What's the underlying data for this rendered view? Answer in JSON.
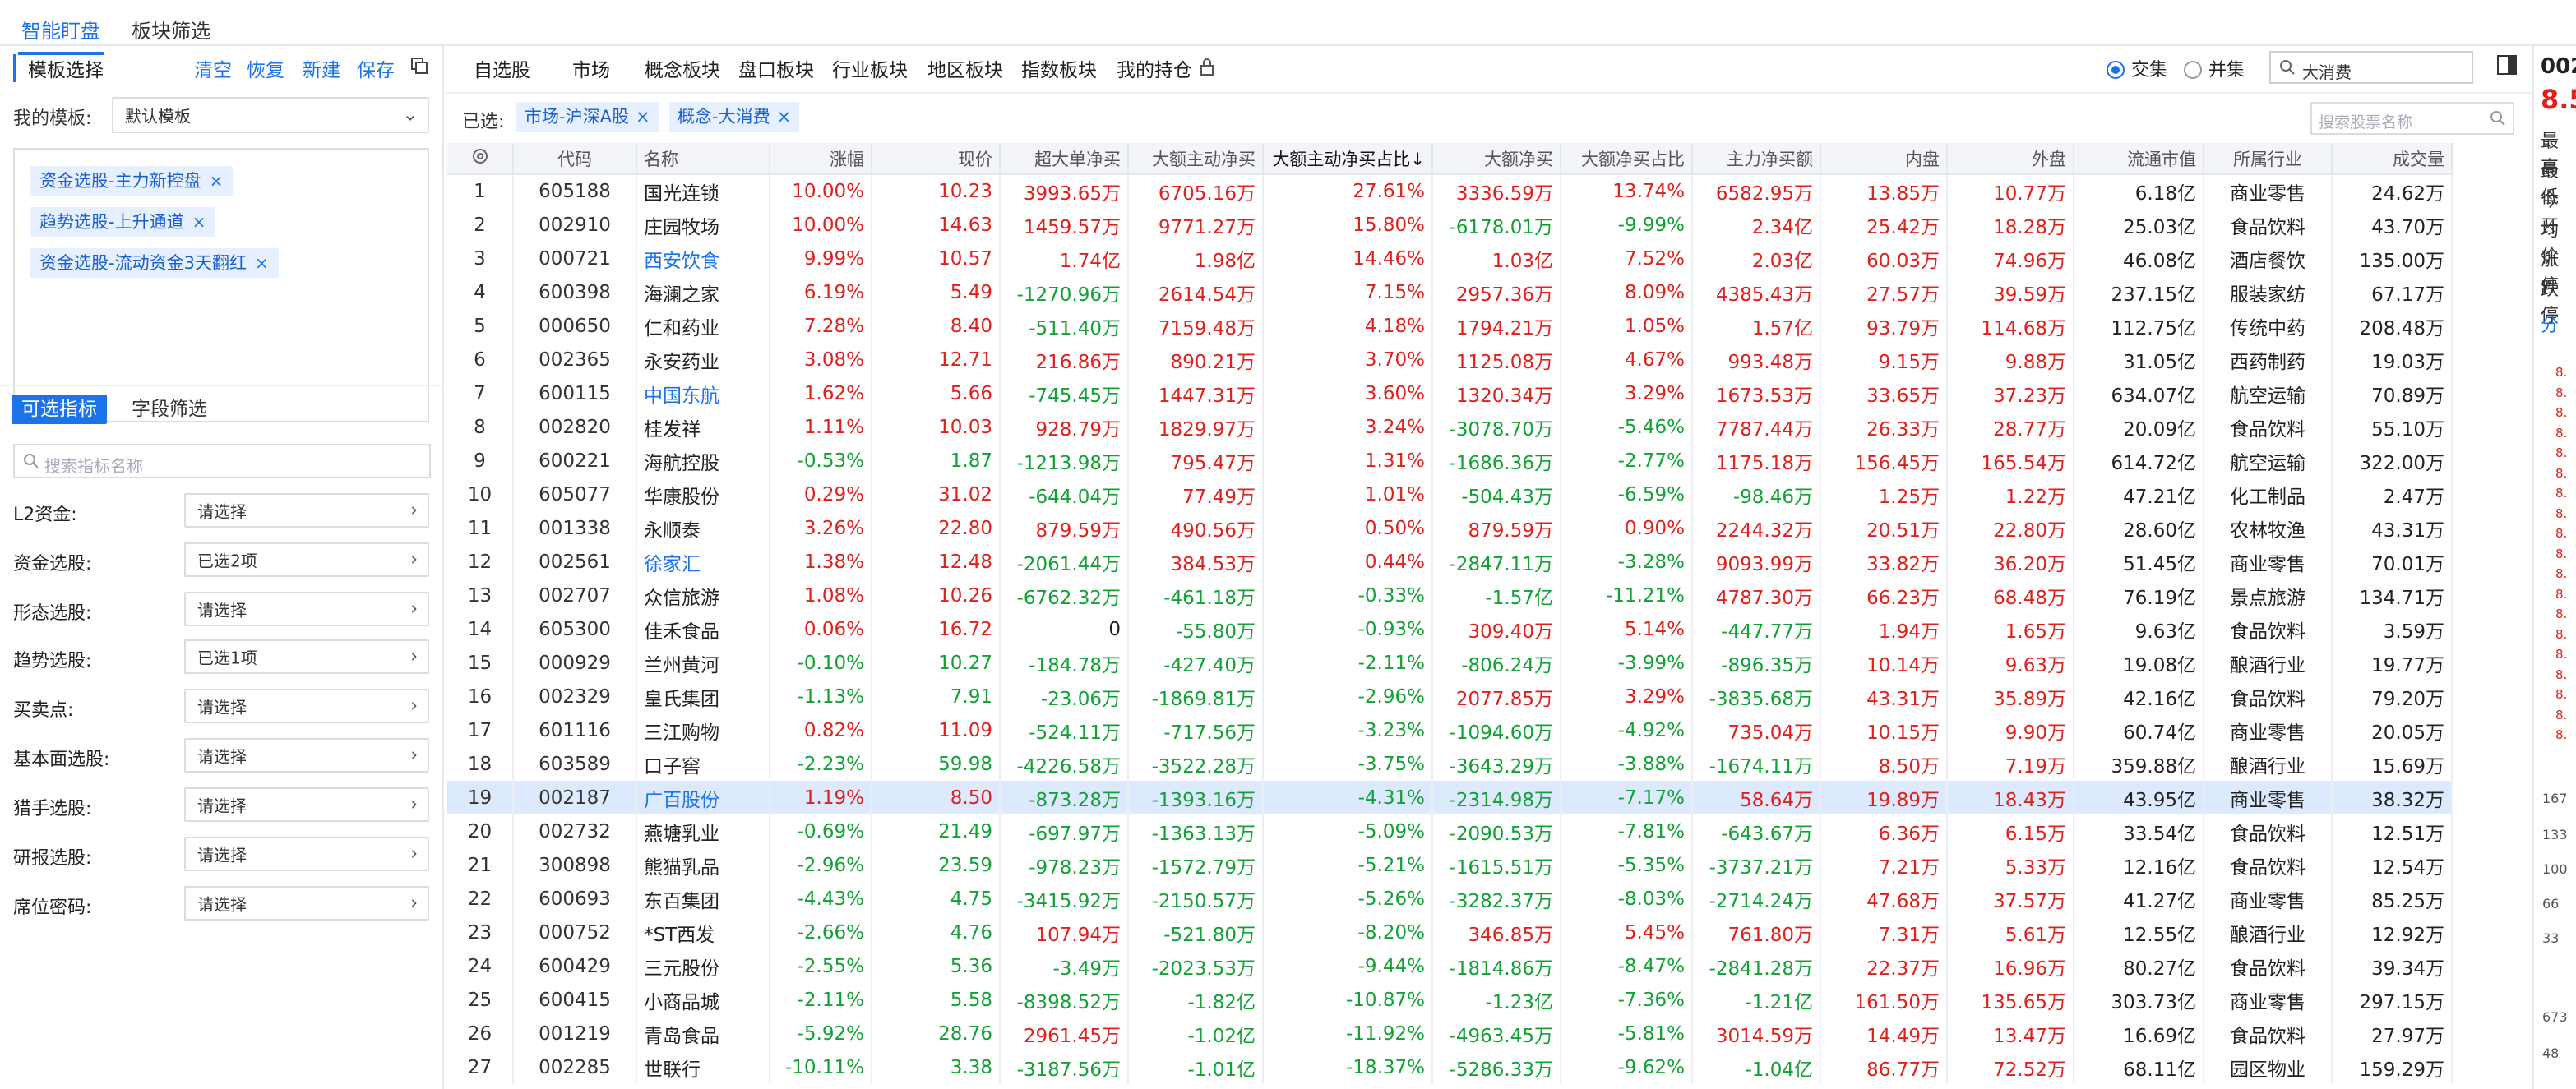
{
  "top_tabs": [
    "智能盯盘",
    "板块筛选"
  ],
  "left": {
    "title": "模板选择",
    "actions": [
      "清空",
      "恢复",
      "新建",
      "保存"
    ],
    "my_template_label": "我的模板:",
    "my_template_value": "默认模板",
    "templates": [
      "资金选股-主力新控盘",
      "趋势选股-上升通道",
      "资金选股-流动资金3天翻红"
    ],
    "subtabs": [
      "可选指标",
      "字段筛选"
    ],
    "indicator_search_placeholder": "搜索指标名称",
    "filters": [
      {
        "label": "L2资金:",
        "value": "请选择"
      },
      {
        "label": "资金选股:",
        "value": "已选2项"
      },
      {
        "label": "形态选股:",
        "value": "请选择"
      },
      {
        "label": "趋势选股:",
        "value": "已选1项"
      },
      {
        "label": "买卖点:",
        "value": "请选择"
      },
      {
        "label": "基本面选股:",
        "value": "请选择"
      },
      {
        "label": "猎手选股:",
        "value": "请选择"
      },
      {
        "label": "研报选股:",
        "value": "请选择"
      },
      {
        "label": "席位密码:",
        "value": "请选择"
      }
    ]
  },
  "nav": {
    "items": [
      "自选股",
      "市场",
      "概念板块",
      "盘口板块",
      "行业板块",
      "地区板块",
      "指数板块",
      "我的持仓"
    ],
    "radio_intersection": "交集",
    "radio_union": "并集",
    "search_value": "大消费"
  },
  "selected": {
    "label": "已选:",
    "tags": [
      "市场-沪深A股",
      "概念-大消费"
    ],
    "stock_search_placeholder": "搜索股票名称"
  },
  "table": {
    "headers": [
      "代码",
      "名称",
      "涨幅",
      "现价",
      "超大单净买",
      "大额主动净买",
      "大额主动净买占比↓",
      "大额净买",
      "大额净买占比",
      "主力净买额",
      "内盘",
      "外盘",
      "流通市值",
      "所属行业",
      "成交量"
    ],
    "rows": [
      [
        "1",
        "605188",
        "国光连锁",
        "10.00%",
        "10.23",
        "3993.65万",
        "6705.16万",
        "27.61%",
        "3336.59万",
        "13.74%",
        "6582.95万",
        "13.85万",
        "10.77万",
        "6.18亿",
        "商业零售",
        "24.62万"
      ],
      [
        "2",
        "002910",
        "庄园牧场",
        "10.00%",
        "14.63",
        "1459.57万",
        "9771.27万",
        "15.80%",
        "-6178.01万",
        "-9.99%",
        "2.34亿",
        "25.42万",
        "18.28万",
        "25.03亿",
        "食品饮料",
        "43.70万"
      ],
      [
        "3",
        "000721",
        "西安饮食",
        "9.99%",
        "10.57",
        "1.74亿",
        "1.98亿",
        "14.46%",
        "1.03亿",
        "7.52%",
        "2.03亿",
        "60.03万",
        "74.96万",
        "46.08亿",
        "酒店餐饮",
        "135.00万"
      ],
      [
        "4",
        "600398",
        "海澜之家",
        "6.19%",
        "5.49",
        "-1270.96万",
        "2614.54万",
        "7.15%",
        "2957.36万",
        "8.09%",
        "4385.43万",
        "27.57万",
        "39.59万",
        "237.15亿",
        "服装家纺",
        "67.17万"
      ],
      [
        "5",
        "000650",
        "仁和药业",
        "7.28%",
        "8.40",
        "-511.40万",
        "7159.48万",
        "4.18%",
        "1794.21万",
        "1.05%",
        "1.57亿",
        "93.79万",
        "114.68万",
        "112.75亿",
        "传统中药",
        "208.48万"
      ],
      [
        "6",
        "002365",
        "永安药业",
        "3.08%",
        "12.71",
        "216.86万",
        "890.21万",
        "3.70%",
        "1125.08万",
        "4.67%",
        "993.48万",
        "9.15万",
        "9.88万",
        "31.05亿",
        "西药制药",
        "19.03万"
      ],
      [
        "7",
        "600115",
        "中国东航",
        "1.62%",
        "5.66",
        "-745.45万",
        "1447.31万",
        "3.60%",
        "1320.34万",
        "3.29%",
        "1673.53万",
        "33.65万",
        "37.23万",
        "634.07亿",
        "航空运输",
        "70.89万"
      ],
      [
        "8",
        "002820",
        "桂发祥",
        "1.11%",
        "10.03",
        "928.79万",
        "1829.97万",
        "3.24%",
        "-3078.70万",
        "-5.46%",
        "7787.44万",
        "26.33万",
        "28.77万",
        "20.09亿",
        "食品饮料",
        "55.10万"
      ],
      [
        "9",
        "600221",
        "海航控股",
        "-0.53%",
        "1.87",
        "-1213.98万",
        "795.47万",
        "1.31%",
        "-1686.36万",
        "-2.77%",
        "1175.18万",
        "156.45万",
        "165.54万",
        "614.72亿",
        "航空运输",
        "322.00万"
      ],
      [
        "10",
        "605077",
        "华康股份",
        "0.29%",
        "31.02",
        "-644.04万",
        "77.49万",
        "1.01%",
        "-504.43万",
        "-6.59%",
        "-98.46万",
        "1.25万",
        "1.22万",
        "47.21亿",
        "化工制品",
        "2.47万"
      ],
      [
        "11",
        "001338",
        "永顺泰",
        "3.26%",
        "22.80",
        "879.59万",
        "490.56万",
        "0.50%",
        "879.59万",
        "0.90%",
        "2244.32万",
        "20.51万",
        "22.80万",
        "28.60亿",
        "农林牧渔",
        "43.31万"
      ],
      [
        "12",
        "002561",
        "徐家汇",
        "1.38%",
        "12.48",
        "-2061.44万",
        "384.53万",
        "0.44%",
        "-2847.11万",
        "-3.28%",
        "9093.99万",
        "33.82万",
        "36.20万",
        "51.45亿",
        "商业零售",
        "70.01万"
      ],
      [
        "13",
        "002707",
        "众信旅游",
        "1.08%",
        "10.26",
        "-6762.32万",
        "-461.18万",
        "-0.33%",
        "-1.57亿",
        "-11.21%",
        "4787.30万",
        "66.23万",
        "68.48万",
        "76.19亿",
        "景点旅游",
        "134.71万"
      ],
      [
        "14",
        "605300",
        "佳禾食品",
        "0.06%",
        "16.72",
        "0",
        "-55.80万",
        "-0.93%",
        "309.40万",
        "5.14%",
        "-447.77万",
        "1.94万",
        "1.65万",
        "9.63亿",
        "食品饮料",
        "3.59万"
      ],
      [
        "15",
        "000929",
        "兰州黄河",
        "-0.10%",
        "10.27",
        "-184.78万",
        "-427.40万",
        "-2.11%",
        "-806.24万",
        "-3.99%",
        "-896.35万",
        "10.14万",
        "9.63万",
        "19.08亿",
        "酿酒行业",
        "19.77万"
      ],
      [
        "16",
        "002329",
        "皇氏集团",
        "-1.13%",
        "7.91",
        "-23.06万",
        "-1869.81万",
        "-2.96%",
        "2077.85万",
        "3.29%",
        "-3835.68万",
        "43.31万",
        "35.89万",
        "42.16亿",
        "食品饮料",
        "79.20万"
      ],
      [
        "17",
        "601116",
        "三江购物",
        "0.82%",
        "11.09",
        "-524.11万",
        "-717.56万",
        "-3.23%",
        "-1094.60万",
        "-4.92%",
        "735.04万",
        "10.15万",
        "9.90万",
        "60.74亿",
        "商业零售",
        "20.05万"
      ],
      [
        "18",
        "603589",
        "口子窖",
        "-2.23%",
        "59.98",
        "-4226.58万",
        "-3522.28万",
        "-3.75%",
        "-3643.29万",
        "-3.88%",
        "-1674.11万",
        "8.50万",
        "7.19万",
        "359.88亿",
        "酿酒行业",
        "15.69万"
      ],
      [
        "19",
        "002187",
        "广百股份",
        "1.19%",
        "8.50",
        "-873.28万",
        "-1393.16万",
        "-4.31%",
        "-2314.98万",
        "-7.17%",
        "58.64万",
        "19.89万",
        "18.43万",
        "43.95亿",
        "商业零售",
        "38.32万"
      ],
      [
        "20",
        "002732",
        "燕塘乳业",
        "-0.69%",
        "21.49",
        "-697.97万",
        "-1363.13万",
        "-5.09%",
        "-2090.53万",
        "-7.81%",
        "-643.67万",
        "6.36万",
        "6.15万",
        "33.54亿",
        "食品饮料",
        "12.51万"
      ],
      [
        "21",
        "300898",
        "熊猫乳品",
        "-2.96%",
        "23.59",
        "-978.23万",
        "-1572.79万",
        "-5.21%",
        "-1615.51万",
        "-5.35%",
        "-3737.21万",
        "7.21万",
        "5.33万",
        "12.16亿",
        "食品饮料",
        "12.54万"
      ],
      [
        "22",
        "600693",
        "东百集团",
        "-4.43%",
        "4.75",
        "-3415.92万",
        "-2150.57万",
        "-5.26%",
        "-3282.37万",
        "-8.03%",
        "-2714.24万",
        "47.68万",
        "37.57万",
        "41.27亿",
        "商业零售",
        "85.25万"
      ],
      [
        "23",
        "000752",
        "*ST西发",
        "-2.66%",
        "4.76",
        "107.94万",
        "-521.80万",
        "-8.20%",
        "346.85万",
        "5.45%",
        "761.80万",
        "7.31万",
        "5.61万",
        "12.55亿",
        "酿酒行业",
        "12.92万"
      ],
      [
        "24",
        "600429",
        "三元股份",
        "-2.55%",
        "5.36",
        "-3.49万",
        "-2023.53万",
        "-9.44%",
        "-1814.86万",
        "-8.47%",
        "-2841.28万",
        "22.37万",
        "16.96万",
        "80.27亿",
        "食品饮料",
        "39.34万"
      ],
      [
        "25",
        "600415",
        "小商品城",
        "-2.11%",
        "5.58",
        "-8398.52万",
        "-1.82亿",
        "-10.87%",
        "-1.23亿",
        "-7.36%",
        "-1.21亿",
        "161.50万",
        "135.65万",
        "303.73亿",
        "商业零售",
        "297.15万"
      ],
      [
        "26",
        "001219",
        "青岛食品",
        "-5.92%",
        "28.76",
        "2961.45万",
        "-1.02亿",
        "-11.92%",
        "-4963.45万",
        "-5.81%",
        "3014.59万",
        "14.49万",
        "13.47万",
        "16.69亿",
        "食品饮料",
        "27.97万"
      ],
      [
        "27",
        "002285",
        "世联行",
        "-10.11%",
        "3.38",
        "-3187.56万",
        "-1.01亿",
        "-18.37%",
        "-5286.33万",
        "-9.62%",
        "-1.04亿",
        "86.77万",
        "72.52万",
        "68.11亿",
        "园区物业",
        "159.29万"
      ]
    ],
    "link_names": [
      "西安饮食",
      "中国东航",
      "徐家汇",
      "广百股份"
    ],
    "selected_row": 19
  },
  "right_panel": {
    "code": "002",
    "price": "8.5",
    "labels": [
      "最高",
      "最低",
      "今开",
      "均价",
      "涨停",
      "跌停"
    ],
    "tab": "分",
    "side_numbers": [
      "8.",
      "8.",
      "8.",
      "8.",
      "8.",
      "8.",
      "8.",
      "8.",
      "8.",
      "8.",
      "8.",
      "8.",
      "8.",
      "8.",
      "8.",
      "8.",
      "8.",
      "8.",
      "8."
    ],
    "axis": [
      "167",
      "133",
      "100",
      "66",
      "33",
      "673",
      "48"
    ]
  }
}
